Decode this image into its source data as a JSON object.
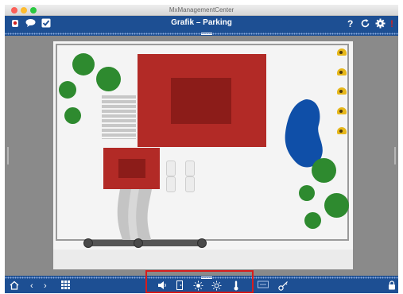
{
  "window": {
    "title": "MxManagementCenter"
  },
  "header": {
    "title": "Grafik – Parking"
  },
  "icons": {
    "header_left": [
      "camera-icon",
      "chat-icon",
      "checkbox-icon"
    ],
    "header_right": [
      "help-icon",
      "refresh-icon",
      "settings-icon",
      "alert-icon"
    ],
    "bottom_left": [
      "home-icon",
      "back-icon",
      "forward-icon",
      "grid-icon"
    ],
    "bottom_tools": [
      "speaker-icon",
      "door-icon",
      "light-icon",
      "light-dimmed-icon",
      "temperature-icon",
      "ticket-icon",
      "key-icon"
    ],
    "bottom_right": [
      "lock-icon"
    ]
  },
  "colors": {
    "brand_blue": "#1d4f93",
    "building_red": "#b22a26",
    "tree_green": "#2e8a2f",
    "pond_blue": "#0f4fa8",
    "camera_yellow": "#e6b71a",
    "highlight_red": "#d81c1c"
  }
}
